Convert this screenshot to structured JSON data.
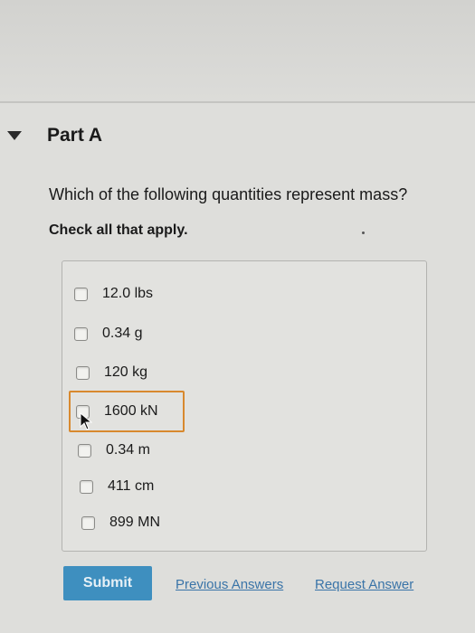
{
  "part": {
    "title": "Part A",
    "expand_icon": "triangle-down-icon"
  },
  "question": {
    "prompt": "Which of the following quantities represent mass?",
    "instruction": "Check all that apply."
  },
  "options": [
    {
      "label": "12.0 lbs",
      "checked": false
    },
    {
      "label": "0.34 g",
      "checked": false
    },
    {
      "label": "120 kg",
      "checked": false
    },
    {
      "label": "1600 kN",
      "checked": false,
      "focused": true
    },
    {
      "label": "0.34 m",
      "checked": false
    },
    {
      "label": "411 cm",
      "checked": false
    },
    {
      "label": "899 MN",
      "checked": false
    }
  ],
  "actions": {
    "submit_label": "Submit",
    "previous_answers_label": "Previous Answers",
    "request_answer_label": "Request Answer"
  },
  "colors": {
    "submit_bg": "#3e8fbf",
    "link": "#3a74a8",
    "focus_outline": "#d8892e"
  }
}
